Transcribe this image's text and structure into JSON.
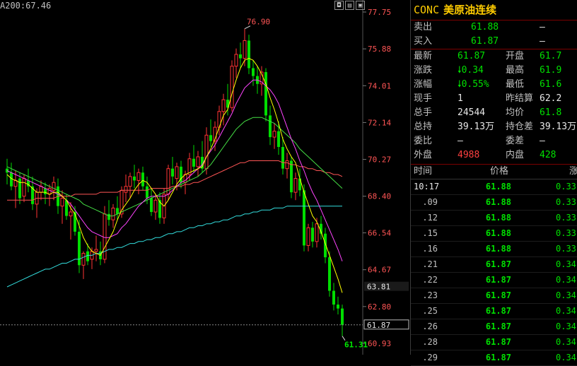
{
  "chart": {
    "ma_label": "A200:67.46",
    "window_buttons": [
      "◘",
      "▤",
      "▣"
    ]
  },
  "colors": {
    "up": "#ff3333",
    "down": "#00dd00",
    "ma5": "#ffff00",
    "ma10": "#ff44ff",
    "ma20": "#44dd44",
    "ma60": "#ff5555",
    "ma200": "#33dddd",
    "axis_red": "#ff5555",
    "axis_green": "#00ee00"
  },
  "chart_data": {
    "type": "candlestick",
    "yticks": [
      77.75,
      75.88,
      74.01,
      72.14,
      70.27,
      68.4,
      66.54,
      64.67,
      62.8,
      60.93
    ],
    "ylim": [
      60.93,
      77.75
    ],
    "high_label": "76.90",
    "low_label": "61.31",
    "last_price_label": "61.87",
    "cursor_price_label": "63.81",
    "candles": [
      [
        69.8,
        70.3,
        69.0,
        69.6
      ],
      [
        69.6,
        70.1,
        68.7,
        68.9
      ],
      [
        68.9,
        69.7,
        67.8,
        69.2
      ],
      [
        69.3,
        69.6,
        68.0,
        68.3
      ],
      [
        68.4,
        69.5,
        68.1,
        69.3
      ],
      [
        69.2,
        69.8,
        68.6,
        68.9
      ],
      [
        68.9,
        69.4,
        67.7,
        68.0
      ],
      [
        68.0,
        68.8,
        67.3,
        68.6
      ],
      [
        68.6,
        69.2,
        68.2,
        68.9
      ],
      [
        68.8,
        69.1,
        68.0,
        68.5
      ],
      [
        68.5,
        69.0,
        67.9,
        68.8
      ],
      [
        68.7,
        69.4,
        68.2,
        69.1
      ],
      [
        68.9,
        69.3,
        67.5,
        67.9
      ],
      [
        67.9,
        68.7,
        67.0,
        68.3
      ],
      [
        68.2,
        68.5,
        67.2,
        67.4
      ],
      [
        67.4,
        68.1,
        66.2,
        67.6
      ],
      [
        67.6,
        67.9,
        66.4,
        66.6
      ],
      [
        66.6,
        67.2,
        64.5,
        64.9
      ],
      [
        64.9,
        65.6,
        64.2,
        65.5
      ],
      [
        65.6,
        66.0,
        64.9,
        65.1
      ],
      [
        65.2,
        65.8,
        64.7,
        65.6
      ],
      [
        65.6,
        66.4,
        65.1,
        65.7
      ],
      [
        65.6,
        66.1,
        64.9,
        65.2
      ],
      [
        65.2,
        67.9,
        65.0,
        67.5
      ],
      [
        67.5,
        68.2,
        66.9,
        67.2
      ],
      [
        67.2,
        68.0,
        66.8,
        67.8
      ],
      [
        67.8,
        68.4,
        67.2,
        67.5
      ],
      [
        67.5,
        68.9,
        67.3,
        68.7
      ],
      [
        68.6,
        69.5,
        68.1,
        68.9
      ],
      [
        68.9,
        69.6,
        68.3,
        69.4
      ],
      [
        69.4,
        70.0,
        68.8,
        69.2
      ],
      [
        69.2,
        69.8,
        68.5,
        69.6
      ],
      [
        69.6,
        69.9,
        68.7,
        68.9
      ],
      [
        68.9,
        69.4,
        68.0,
        68.3
      ],
      [
        68.3,
        68.8,
        67.4,
        67.6
      ],
      [
        67.6,
        68.5,
        67.2,
        68.2
      ],
      [
        68.2,
        68.6,
        67.0,
        67.3
      ],
      [
        67.3,
        68.8,
        67.0,
        68.5
      ],
      [
        68.5,
        70.0,
        68.2,
        69.8
      ],
      [
        69.8,
        70.4,
        69.0,
        69.4
      ],
      [
        69.3,
        70.1,
        68.7,
        69.9
      ],
      [
        69.9,
        70.2,
        68.8,
        69.1
      ],
      [
        69.1,
        69.7,
        68.5,
        69.5
      ],
      [
        69.5,
        70.6,
        69.2,
        70.3
      ],
      [
        70.3,
        71.0,
        69.6,
        69.9
      ],
      [
        69.9,
        70.7,
        69.4,
        70.4
      ],
      [
        70.4,
        71.2,
        69.6,
        69.8
      ],
      [
        69.8,
        71.9,
        69.5,
        71.5
      ],
      [
        71.5,
        72.3,
        70.9,
        71.2
      ],
      [
        71.2,
        72.2,
        70.7,
        71.9
      ],
      [
        71.9,
        73.0,
        71.5,
        72.7
      ],
      [
        72.7,
        73.6,
        72.0,
        73.3
      ],
      [
        73.3,
        74.1,
        72.5,
        72.9
      ],
      [
        72.9,
        75.3,
        72.7,
        75.0
      ],
      [
        75.0,
        75.9,
        74.4,
        75.6
      ],
      [
        75.6,
        76.2,
        74.9,
        75.4
      ],
      [
        75.4,
        76.9,
        75.0,
        76.3
      ],
      [
        76.3,
        76.6,
        74.6,
        74.9
      ],
      [
        74.9,
        75.3,
        74.0,
        74.5
      ],
      [
        74.5,
        75.0,
        73.6,
        74.1
      ],
      [
        74.1,
        75.0,
        73.5,
        74.7
      ],
      [
        74.7,
        74.9,
        72.2,
        72.5
      ],
      [
        72.5,
        73.0,
        71.0,
        71.4
      ],
      [
        71.4,
        72.1,
        70.8,
        71.7
      ],
      [
        71.7,
        72.2,
        70.5,
        70.9
      ],
      [
        70.9,
        71.4,
        69.5,
        69.8
      ],
      [
        69.8,
        70.6,
        69.3,
        70.2
      ],
      [
        70.2,
        70.4,
        68.3,
        68.6
      ],
      [
        68.6,
        69.6,
        68.2,
        69.3
      ],
      [
        69.3,
        69.8,
        68.4,
        68.7
      ],
      [
        68.7,
        69.0,
        65.6,
        65.9
      ],
      [
        65.9,
        67.0,
        65.6,
        66.8
      ],
      [
        66.8,
        67.1,
        65.8,
        66.1
      ],
      [
        66.1,
        67.3,
        65.8,
        67.0
      ],
      [
        67.0,
        67.4,
        66.2,
        66.5
      ],
      [
        66.5,
        66.8,
        65.0,
        65.3
      ],
      [
        65.3,
        65.6,
        63.3,
        63.6
      ],
      [
        63.6,
        64.0,
        62.6,
        62.9
      ],
      [
        62.9,
        63.3,
        62.4,
        62.7
      ],
      [
        62.7,
        62.9,
        61.3,
        61.87
      ]
    ],
    "ma5": [
      69.5,
      69.3,
      69.2,
      69.1,
      69.1,
      69.0,
      68.8,
      68.6,
      68.6,
      68.6,
      68.5,
      68.6,
      68.6,
      68.4,
      68.2,
      67.8,
      67.5,
      66.9,
      66.3,
      65.9,
      65.6,
      65.5,
      65.4,
      65.8,
      66.2,
      66.6,
      67.2,
      67.7,
      68.0,
      68.3,
      68.7,
      69.0,
      69.2,
      69.1,
      68.8,
      68.5,
      68.1,
      67.9,
      68.2,
      68.6,
      69.0,
      69.3,
      69.5,
      69.6,
      69.7,
      69.8,
      69.9,
      70.4,
      70.8,
      71.3,
      71.9,
      72.5,
      72.8,
      73.6,
      74.3,
      74.9,
      75.3,
      75.4,
      75.3,
      75.0,
      74.6,
      74.1,
      73.4,
      72.8,
      72.1,
      71.3,
      70.8,
      70.4,
      70.1,
      69.3,
      68.6,
      68.0,
      67.4,
      67.1,
      66.6,
      66.0,
      65.4,
      64.8,
      64.2,
      63.5
    ],
    "ma10": [
      69.7,
      69.6,
      69.5,
      69.4,
      69.3,
      69.2,
      69.1,
      69.0,
      68.9,
      68.8,
      68.7,
      68.6,
      68.5,
      68.4,
      68.2,
      68.0,
      67.7,
      67.4,
      67.1,
      66.8,
      66.6,
      66.5,
      66.4,
      66.3,
      66.3,
      66.4,
      66.5,
      66.8,
      67.0,
      67.3,
      67.6,
      67.9,
      68.1,
      68.3,
      68.4,
      68.4,
      68.4,
      68.4,
      68.5,
      68.7,
      68.9,
      69.1,
      69.2,
      69.4,
      69.6,
      69.8,
      70.0,
      70.4,
      70.7,
      71.0,
      71.4,
      71.8,
      72.2,
      72.6,
      73.1,
      73.5,
      73.9,
      74.1,
      74.3,
      74.3,
      74.2,
      74.0,
      73.8,
      73.5,
      73.1,
      72.5,
      71.9,
      71.3,
      70.8,
      70.2,
      69.7,
      69.1,
      68.6,
      68.2,
      67.7,
      67.2,
      66.7,
      66.2,
      65.7,
      65.1
    ],
    "ma20": [
      69.9,
      69.8,
      69.7,
      69.6,
      69.5,
      69.4,
      69.3,
      69.2,
      69.1,
      69.0,
      68.9,
      68.8,
      68.7,
      68.6,
      68.5,
      68.4,
      68.3,
      68.2,
      68.0,
      67.9,
      67.8,
      67.7,
      67.6,
      67.5,
      67.4,
      67.4,
      67.5,
      67.6,
      67.7,
      67.8,
      67.9,
      68.0,
      68.1,
      68.2,
      68.3,
      68.4,
      68.5,
      68.6,
      68.7,
      68.8,
      68.9,
      69.0,
      69.1,
      69.2,
      69.3,
      69.4,
      69.6,
      69.8,
      70.0,
      70.3,
      70.6,
      70.9,
      71.2,
      71.5,
      71.8,
      72.0,
      72.2,
      72.3,
      72.4,
      72.4,
      72.4,
      72.3,
      72.2,
      72.1,
      71.9,
      71.7,
      71.5,
      71.3,
      71.1,
      70.8,
      70.6,
      70.4,
      70.2,
      70.0,
      69.8,
      69.6,
      69.4,
      69.2,
      69.0,
      68.8
    ],
    "ma60": [
      68.2,
      68.2,
      68.2,
      68.2,
      68.2,
      68.2,
      68.2,
      68.3,
      68.3,
      68.3,
      68.3,
      68.3,
      68.4,
      68.4,
      68.4,
      68.4,
      68.5,
      68.5,
      68.5,
      68.5,
      68.5,
      68.5,
      68.6,
      68.6,
      68.6,
      68.6,
      68.6,
      68.7,
      68.7,
      68.7,
      68.7,
      68.7,
      68.7,
      68.7,
      68.8,
      68.8,
      68.8,
      68.8,
      68.8,
      68.9,
      68.9,
      68.9,
      69.0,
      69.0,
      69.1,
      69.1,
      69.2,
      69.3,
      69.4,
      69.5,
      69.6,
      69.7,
      69.8,
      69.9,
      70.0,
      70.1,
      70.1,
      70.2,
      70.2,
      70.2,
      70.2,
      70.2,
      70.2,
      70.2,
      70.2,
      70.1,
      70.1,
      70.0,
      70.0,
      69.9,
      69.9,
      69.8,
      69.8,
      69.7,
      69.7,
      69.6,
      69.6,
      69.5,
      69.5,
      69.4
    ],
    "ma200": [
      63.8,
      63.9,
      64.0,
      64.1,
      64.2,
      64.3,
      64.4,
      64.5,
      64.6,
      64.7,
      64.7,
      64.8,
      64.9,
      65.0,
      65.0,
      65.1,
      65.2,
      65.2,
      65.3,
      65.4,
      65.4,
      65.5,
      65.5,
      65.6,
      65.7,
      65.7,
      65.8,
      65.8,
      65.9,
      66.0,
      66.0,
      66.1,
      66.1,
      66.2,
      66.2,
      66.3,
      66.3,
      66.4,
      66.5,
      66.5,
      66.6,
      66.6,
      66.7,
      66.8,
      66.8,
      66.9,
      66.9,
      67.0,
      67.0,
      67.1,
      67.1,
      67.2,
      67.2,
      67.3,
      67.4,
      67.4,
      67.5,
      67.5,
      67.6,
      67.6,
      67.7,
      67.7,
      67.7,
      67.8,
      67.8,
      67.8,
      67.9,
      67.9,
      67.9,
      67.9,
      67.9,
      67.9,
      67.9,
      67.9,
      67.9,
      67.9,
      67.9,
      67.9,
      67.9,
      67.9
    ]
  },
  "quote": {
    "code": "CONC",
    "name": "美原油连续",
    "sell_label": "卖出",
    "sell_price": "61.88",
    "sell_vol": "—",
    "buy_label": "买入",
    "buy_price": "61.87",
    "buy_vol": "—",
    "stats": [
      {
        "l1": "最新",
        "v1": "61.87",
        "c1": "g",
        "l2": "开盘",
        "v2": "61.7",
        "c2": "g"
      },
      {
        "l1": "涨跌",
        "v1": "🠗0.34",
        "c1": "g",
        "l2": "最高",
        "v2": "61.9",
        "c2": "g"
      },
      {
        "l1": "涨幅",
        "v1": "🠗0.55%",
        "c1": "g",
        "l2": "最低",
        "v2": "61.6",
        "c2": "g"
      },
      {
        "l1": "现手",
        "v1": "1",
        "c1": "w",
        "l2": "昨结算",
        "v2": "62.2",
        "c2": "w"
      },
      {
        "l1": "总手",
        "v1": "24544",
        "c1": "w",
        "l2": "均价",
        "v2": "61.8",
        "c2": "g"
      },
      {
        "l1": "总持",
        "v1": "39.13万",
        "c1": "w",
        "l2": "持仓差",
        "v2": "39.13万",
        "c2": "w"
      },
      {
        "l1": "委比",
        "v1": "—",
        "c1": "w",
        "l2": "委差",
        "v2": "—",
        "c2": "w"
      },
      {
        "l1": "外盘",
        "v1": "4988",
        "c1": "r",
        "l2": "内盘",
        "v2": "428",
        "c2": "g"
      }
    ],
    "ticks_header": {
      "time": "时间",
      "price": "价格",
      "change": "涨"
    },
    "ticks": [
      {
        "time": "10:17",
        "price": "61.88",
        "change": "0.33"
      },
      {
        "time": ".09",
        "price": "61.88",
        "change": "0.33"
      },
      {
        "time": ".12",
        "price": "61.88",
        "change": "0.33"
      },
      {
        "time": ".15",
        "price": "61.88",
        "change": "0.33"
      },
      {
        "time": ".16",
        "price": "61.88",
        "change": "0.33"
      },
      {
        "time": ".21",
        "price": "61.87",
        "change": "0.34"
      },
      {
        "time": ".22",
        "price": "61.87",
        "change": "0.34"
      },
      {
        "time": ".23",
        "price": "61.87",
        "change": "0.34"
      },
      {
        "time": ".25",
        "price": "61.87",
        "change": "0.34"
      },
      {
        "time": ".26",
        "price": "61.87",
        "change": "0.34"
      },
      {
        "time": ".28",
        "price": "61.87",
        "change": "0.34"
      },
      {
        "time": ".29",
        "price": "61.87",
        "change": "0.34"
      }
    ]
  }
}
